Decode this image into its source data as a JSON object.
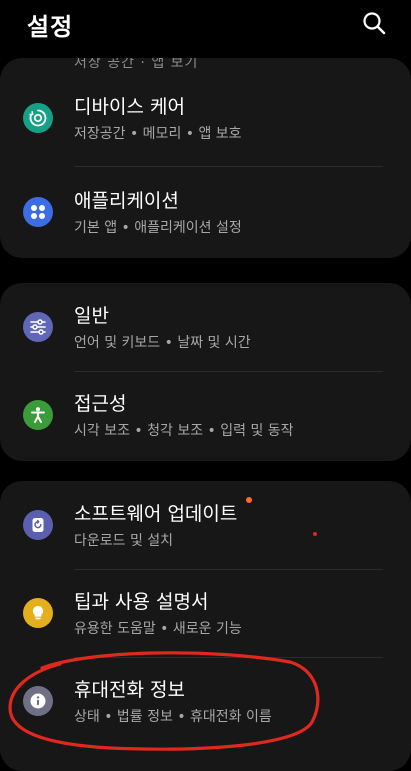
{
  "header": {
    "title": "설정",
    "search_icon": "search-icon"
  },
  "colors": {
    "background": "#000000",
    "card": "#171717",
    "device_care_icon": "#16a187",
    "apps_icon": "#3c6de5",
    "general_icon": "#5f67b6",
    "accessibility_icon": "#3b9b3a",
    "software_update_icon": "#5b5fb0",
    "tips_icon": "#e3b01c",
    "about_phone_icon": "#6f6f86",
    "badge": "#ff6b2d",
    "annotation": "#e0281e"
  },
  "groups": [
    {
      "partial_subtitle": "저장 공간 · 앱 보기",
      "items": [
        {
          "title": "디바이스 케어",
          "subtitle": "저장공간 • 메모리 • 앱 보호",
          "icon": "device-care-icon"
        },
        {
          "title": "애플리케이션",
          "subtitle": "기본 앱 • 애플리케이션 설정",
          "icon": "apps-icon"
        }
      ]
    },
    {
      "items": [
        {
          "title": "일반",
          "subtitle": "언어 및 키보드 • 날짜 및 시간",
          "icon": "sliders-icon"
        },
        {
          "title": "접근성",
          "subtitle": "시각 보조 • 청각 보조 • 입력 및 동작",
          "icon": "accessibility-icon"
        }
      ]
    },
    {
      "items": [
        {
          "title": "소프트웨어 업데이트",
          "subtitle": "다운로드 및 설치",
          "icon": "software-update-icon",
          "badge": true
        },
        {
          "title": "팁과 사용 설명서",
          "subtitle": "유용한 도움말 • 새로운 기능",
          "icon": "lightbulb-icon"
        },
        {
          "title": "휴대전화 정보",
          "subtitle": "상태 • 법률 정보 • 휴대전화 이름",
          "icon": "info-icon"
        }
      ]
    }
  ]
}
